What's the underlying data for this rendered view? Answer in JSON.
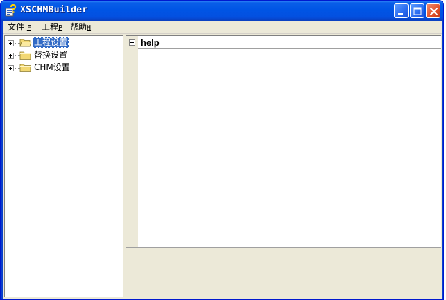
{
  "window": {
    "title": "XSCHMBuilder",
    "controls": [
      "minimize-icon",
      "maximize-icon",
      "close-icon"
    ]
  },
  "menu": {
    "items": [
      {
        "label": "文件",
        "key": "F"
      },
      {
        "label": "工程",
        "key": "P"
      },
      {
        "label": "帮助",
        "key": "H"
      }
    ]
  },
  "tree": {
    "items": [
      {
        "label": "工程设置",
        "selected": true,
        "icon": "open-folder-icon"
      },
      {
        "label": "替换设置",
        "selected": false,
        "icon": "folder-icon"
      },
      {
        "label": "CHM设置",
        "selected": false,
        "icon": "folder-icon"
      }
    ]
  },
  "help_panel": {
    "title": "help"
  },
  "colors": {
    "titlebar": "#0055e5",
    "selection": "#316ac5",
    "face": "#ece9d8"
  }
}
